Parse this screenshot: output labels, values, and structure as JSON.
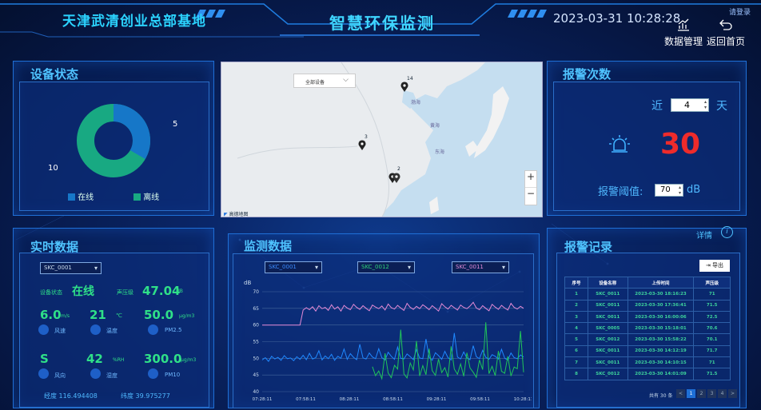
{
  "header": {
    "site_name": "天津武清创业总部基地",
    "title": "智慧环保监测",
    "datetime": "2023-03-31 10:28:28",
    "login": "请登录",
    "data_mgmt": "数据管理",
    "back_home": "返回首页"
  },
  "device_status": {
    "title": "设备状态",
    "online_count": "5",
    "offline_count": "10",
    "legend_online": "在线",
    "legend_offline": "离线",
    "online_fraction": 0.333,
    "colors": {
      "online": "#1677c8",
      "offline": "#18a982"
    }
  },
  "map": {
    "selector": "全部设备",
    "markers": [
      "14",
      "3",
      "2"
    ],
    "labels": {
      "bohai": "渤海",
      "huanghai": "黄海",
      "donghai": "东海"
    },
    "logo": "高德地图",
    "zoom_in": "+",
    "zoom_out": "−"
  },
  "alarm_count": {
    "title": "报警次数",
    "near_label": "近",
    "days_value": "4",
    "day_label": "天",
    "count": "30",
    "threshold_label": "报警阈值:",
    "threshold_value": "70",
    "threshold_unit": "dB"
  },
  "realtime": {
    "title": "实时数据",
    "device_select": "SKC_0001",
    "status_label": "设备状态",
    "status_value": "在线",
    "noise_label": "声压级",
    "noise_value": "47.04",
    "noise_unit": "dB",
    "wind_speed_value": "6.0",
    "wind_speed_unit": "m/s",
    "wind_speed_label": "风速",
    "temp_value": "21",
    "temp_unit": "℃",
    "temp_label": "温度",
    "pm25_value": "50.0",
    "pm25_unit": "μg/m3",
    "pm25_label": "PM2.5",
    "wind_dir_value": "S",
    "wind_dir_label": "风向",
    "humidity_value": "42",
    "humidity_unit": "%RH",
    "humidity_label": "湿度",
    "pm10_value": "300.0",
    "pm10_unit": "μg/m3",
    "pm10_label": "PM10",
    "longitude": "经度 116.494408",
    "latitude": "纬度 39.975277"
  },
  "monitor": {
    "title": "监测数据",
    "selectors": [
      "SKC_0001",
      "SKC_0012",
      "SKC_0011"
    ],
    "selector_colors": [
      "#3b8cff",
      "#2fd27a",
      "#e38bd9"
    ]
  },
  "chart_data": {
    "type": "line",
    "ylabel": "dB",
    "ylim": [
      40,
      70
    ],
    "yticks": [
      "70",
      "65",
      "60",
      "55",
      "50",
      "45",
      "40"
    ],
    "xticks": [
      "07:28:11",
      "07:58:11",
      "08:28:11",
      "08:58:11",
      "09:28:11",
      "09:58:11",
      "10:28:11"
    ],
    "series": [
      {
        "color": "#e58ad6",
        "values": [
          60,
          60,
          60,
          60,
          60,
          60,
          60,
          60,
          60,
          60,
          60,
          60,
          60,
          64.5,
          65.2,
          64.6,
          65.5,
          64.2,
          65.8,
          64.9,
          65.3,
          64.4,
          66.1,
          64.8,
          65.5,
          64.2,
          65.9,
          65.1,
          64.6,
          66.2,
          65.3,
          64.7,
          65.8,
          65.0,
          64.3,
          66.0,
          65.4,
          64.9,
          65.7,
          64.5,
          66.3,
          65.2,
          64.8,
          65.9,
          65.1,
          64.4,
          66.5,
          65.3,
          64.7,
          65.6,
          64.9,
          66.1,
          65.4,
          64.6,
          65.8,
          65.0,
          64.2,
          66.4,
          65.5,
          64.8,
          65.9,
          65.2,
          64.5,
          66.0,
          65.3,
          64.9,
          65.7,
          66.8,
          65.1,
          64.6,
          65.8,
          65.0,
          64.3,
          66.2,
          65.4,
          64.7,
          65.9,
          65.1,
          64.5,
          66.5,
          65.3,
          64.8,
          65.6,
          65.0
        ]
      },
      {
        "color": "#1f88ff",
        "values": [
          49.5,
          50.2,
          49.1,
          50.6,
          49.8,
          50.3,
          49.4,
          50.8,
          49.9,
          50.1,
          49.3,
          50.5,
          49.7,
          50.9,
          49.6,
          51.5,
          49.8,
          50.2,
          52.3,
          49.5,
          50.7,
          49.9,
          51.2,
          49.4,
          50.6,
          50.0,
          52.8,
          49.7,
          51.4,
          50.3,
          49.6,
          54.2,
          50.1,
          49.8,
          51.6,
          50.4,
          49.9,
          52.9,
          50.2,
          49.5,
          51.8,
          50.6,
          49.7,
          53.4,
          50.0,
          49.8,
          51.3,
          50.5,
          49.6,
          52.6,
          50.1,
          49.9,
          55.8,
          50.3,
          49.4,
          51.7,
          50.8,
          49.7,
          52.1,
          50.2,
          49.5,
          57.6,
          50.4,
          49.8,
          51.9,
          50.1,
          49.6,
          53.8,
          50.5,
          49.9,
          52.4,
          50.3,
          49.7,
          51.1,
          50.6,
          49.8,
          52.7,
          50.0,
          49.5,
          51.6,
          50.2,
          49.9,
          51.0,
          50.4
        ]
      },
      {
        "color": "#20c45a",
        "values": [
          null,
          null,
          null,
          null,
          null,
          null,
          null,
          null,
          null,
          null,
          null,
          null,
          null,
          null,
          null,
          null,
          null,
          null,
          null,
          null,
          null,
          null,
          null,
          null,
          null,
          null,
          null,
          null,
          null,
          null,
          null,
          null,
          null,
          null,
          null,
          47.5,
          44.8,
          46.2,
          43.9,
          51.5,
          45.6,
          44.2,
          47.9,
          46.8,
          58.6,
          45.3,
          44.1,
          48.6,
          46.5,
          55.2,
          44.7,
          47.8,
          45.1,
          52.9,
          46.3,
          44.9,
          49.8,
          45.7,
          47.2,
          44.4,
          53.6,
          46.8,
          45.2,
          48.3,
          44.6,
          51.7,
          47.1,
          45.8,
          44.3,
          49.5,
          46.6,
          60.8,
          45.4,
          47.6,
          44.8,
          52.2,
          46.1,
          45.5,
          50.6,
          44.7,
          47.4,
          46.9,
          58.2,
          45.8
        ]
      }
    ]
  },
  "alarm_log": {
    "title": "报警记录",
    "detail": "详情",
    "export": "导出",
    "columns": [
      "序号",
      "设备名称",
      "上传时间",
      "声压级"
    ],
    "rows": [
      [
        "1",
        "SKC_0011",
        "2023-03-30 18:16:23",
        "71"
      ],
      [
        "2",
        "SKC_0011",
        "2023-03-30 17:36:41",
        "71.5"
      ],
      [
        "3",
        "SKC_0011",
        "2023-03-30 16:00:06",
        "72.5"
      ],
      [
        "4",
        "SKC_0005",
        "2023-03-30 15:18:01",
        "70.6"
      ],
      [
        "5",
        "SKC_0012",
        "2023-03-30 15:58:22",
        "70.1"
      ],
      [
        "6",
        "SKC_0011",
        "2023-03-30 14:12:19",
        "71.7"
      ],
      [
        "7",
        "SKC_0011",
        "2023-03-30 14:10:15",
        "71"
      ],
      [
        "8",
        "SKC_0012",
        "2023-03-30 14:01:09",
        "71.5"
      ]
    ],
    "pagination": {
      "total": "共有 30 条",
      "pages": [
        "1",
        "2",
        "3",
        "4"
      ],
      "prev": "<",
      "next": ">"
    }
  }
}
